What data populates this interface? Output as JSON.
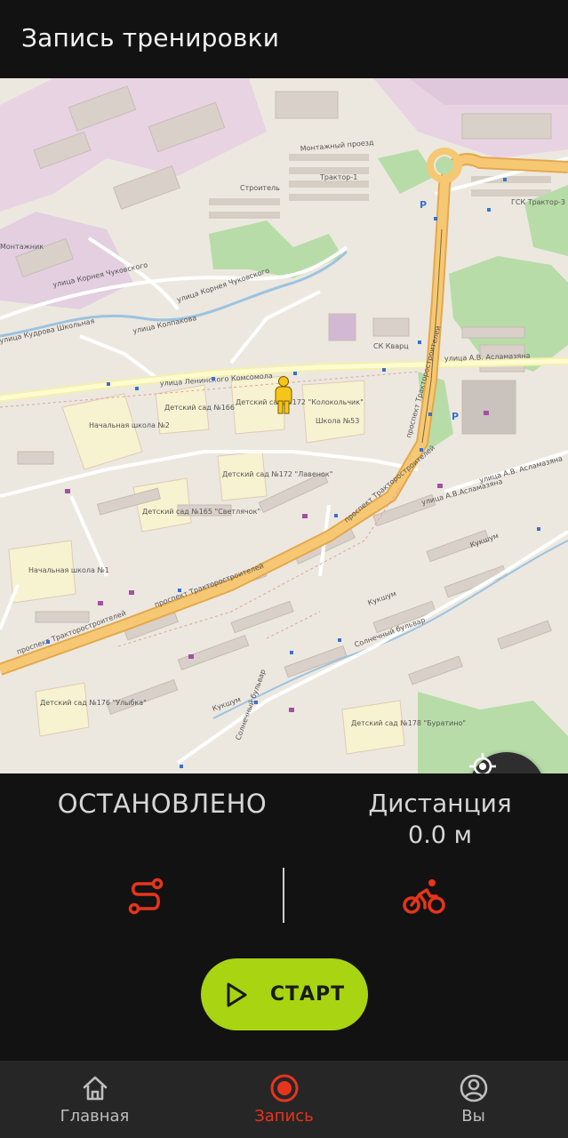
{
  "header": {
    "title": "Запись тренировки"
  },
  "map": {
    "labels": {
      "street_chukovsky_1": "улица Корнея Чуковского",
      "street_chukovsky_2": "улица Корнея Чуковского",
      "street_lenkomsomol": "улица Ленинского Комсомола",
      "street_kolpakova": "улица Колпакова",
      "street_shatrov": "улица Кудрова Школьная",
      "street_aslamazyan_1": "улица А.В. Асламазяна",
      "street_aslamazyan_2": "улица А.В. Асламазяна",
      "street_aslamazyan_3": "улица А.В.Асламазяна",
      "prospekt_1": "проспект Тракторостроителей",
      "prospekt_2": "проспект Тракторостроителей",
      "prospekt_3": "проспект Тракторостроителей",
      "prospekt_4": "проспект Тракторостроителей",
      "bulvar": "Солнечный бульвар",
      "bulvar2": "Солнечный бульвар",
      "proezd": "Монтажный проезд",
      "traktor": "Трактор-1",
      "stroitel": "Строитель",
      "gsk": "ГСК Трактор-3",
      "kinder_1": "Детский сад №166",
      "kinder_2": "Детский сад №172 \"Колокольчик\"",
      "kinder_3": "Детский сад №172 \"Лавенок\"",
      "kinder_4": "Детский сад №165 \"Светлячок\"",
      "kinder_5": "Детский сад №178 \"Буратино\"",
      "kinder_6": "Детский сад №176 \"Улыбка\"",
      "school_1": "Начальная школа №2",
      "school_2": "Школа №53",
      "school_3": "Начальная школа №1",
      "kukshum_1": "Кукшум",
      "kukshum_2": "Кукшум",
      "kukshum_3": "Кукшум",
      "montazh": "Монтажник",
      "ski": "СК Кварц"
    }
  },
  "recording": {
    "status": "ОСТАНОВЛЕНО",
    "distance_label": "Дистанция",
    "distance_value": "0.0 м",
    "start_label": "СТАРТ"
  },
  "icons": {
    "locate": "crosshair-icon",
    "route": "route-icon",
    "bike": "bicycle-icon",
    "play": "play-icon",
    "home": "home-icon",
    "record": "record-icon",
    "profile": "profile-icon",
    "pegman": "pegman-icon"
  },
  "nav": {
    "home": "Главная",
    "record": "Запись",
    "profile": "Вы"
  },
  "colors": {
    "accent": "#e8341c",
    "start": "#a8d412",
    "background": "#121212",
    "nav_background": "#262626",
    "road_major": "#f7c873"
  }
}
